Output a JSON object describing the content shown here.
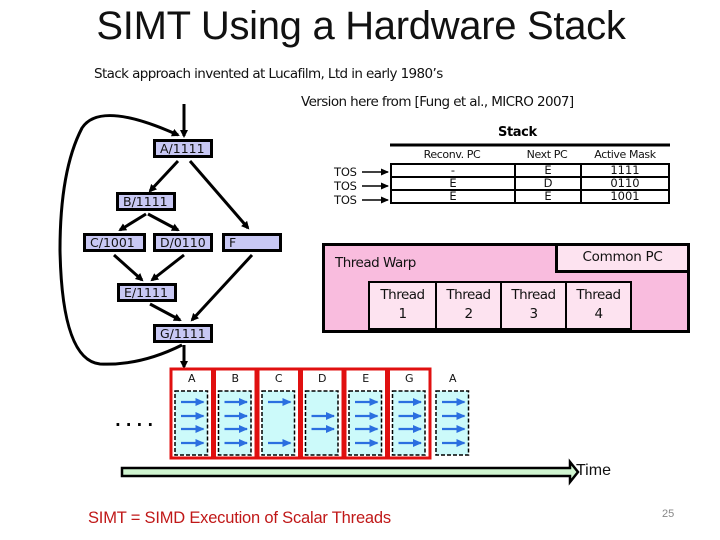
{
  "slide": {
    "title": "SIMT Using a Hardware Stack",
    "subtitle": "Stack approach invented at Lucafilm, Ltd in early 1980’s",
    "citation": "Version here from [Fung et al., MICRO 2007]",
    "page_number": "25",
    "footer": "SIMT = SIMD Execution of Scalar Threads"
  },
  "cfg": {
    "nodes": {
      "A": "A/1111",
      "B": "B/1111",
      "C": "C/1001",
      "D": "D/0110",
      "E": "E/1111",
      "F": "F",
      "G": "G/1111"
    },
    "edges": [
      [
        "entry",
        "A"
      ],
      [
        "A",
        "B"
      ],
      [
        "A",
        "F"
      ],
      [
        "B",
        "C"
      ],
      [
        "B",
        "D"
      ],
      [
        "C",
        "E"
      ],
      [
        "D",
        "E"
      ],
      [
        "E",
        "G"
      ],
      [
        "F",
        "G"
      ],
      [
        "G",
        "A"
      ],
      [
        "G",
        "timeline"
      ]
    ]
  },
  "stack": {
    "title": "Stack",
    "columns": [
      "Reconv. PC",
      "Next PC",
      "Active Mask"
    ],
    "tos_label": "TOS",
    "rows": [
      [
        "-",
        "E",
        "1111"
      ],
      [
        "E",
        "D",
        "0110"
      ],
      [
        "E",
        "E",
        "1001"
      ]
    ]
  },
  "warp": {
    "label": "Thread Warp",
    "common_pc": "Common PC",
    "threads": [
      {
        "name": "Thread",
        "num": "1"
      },
      {
        "name": "Thread",
        "num": "2"
      },
      {
        "name": "Thread",
        "num": "3"
      },
      {
        "name": "Thread",
        "num": "4"
      }
    ]
  },
  "timeline": {
    "ellipsis": "....",
    "time_label": "Time",
    "steps": [
      {
        "label": "A",
        "mask": [
          1,
          1,
          1,
          1
        ],
        "highlighted": true
      },
      {
        "label": "B",
        "mask": [
          1,
          1,
          1,
          1
        ],
        "highlighted": true
      },
      {
        "label": "C",
        "mask": [
          1,
          0,
          0,
          1
        ],
        "highlighted": true
      },
      {
        "label": "D",
        "mask": [
          0,
          1,
          1,
          0
        ],
        "highlighted": true
      },
      {
        "label": "E",
        "mask": [
          1,
          1,
          1,
          1
        ],
        "highlighted": true
      },
      {
        "label": "G",
        "mask": [
          1,
          1,
          1,
          1
        ],
        "highlighted": true
      },
      {
        "label": "A",
        "mask": [
          1,
          1,
          1,
          1
        ],
        "highlighted": false
      }
    ]
  },
  "colors": {
    "node_fill": "#c8c8f4",
    "warp_fill": "#f9bcde",
    "thread_fill": "#fde3f0",
    "lane_fill": "#ccfafa",
    "lane_arrow": "#2b6fe0",
    "highlight_border": "#e01010",
    "time_arrow_fill": "#d0f5d0",
    "footer_text": "#c01818"
  }
}
